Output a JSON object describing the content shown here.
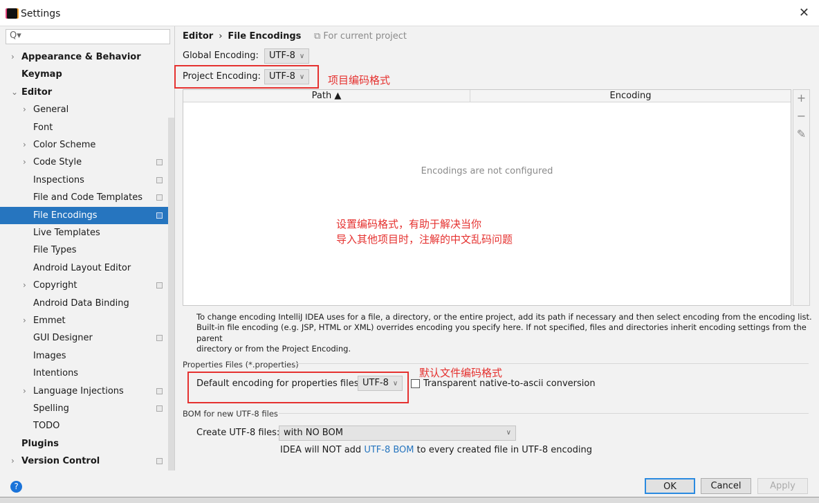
{
  "window": {
    "title": "Settings",
    "close_icon": "close-icon"
  },
  "sidebar": {
    "search_placeholder": "Q▾",
    "items": [
      {
        "label": "Appearance & Behavior",
        "level": 0,
        "bold": true,
        "arrow": "›",
        "project": false
      },
      {
        "label": "Keymap",
        "level": 0,
        "bold": true,
        "arrow": "",
        "project": false
      },
      {
        "label": "Editor",
        "level": 0,
        "bold": true,
        "arrow": "⌄",
        "project": false
      },
      {
        "label": "General",
        "level": 1,
        "arrow": "›",
        "project": false
      },
      {
        "label": "Font",
        "level": 1,
        "arrow": "",
        "project": false
      },
      {
        "label": "Color Scheme",
        "level": 1,
        "arrow": "›",
        "project": false
      },
      {
        "label": "Code Style",
        "level": 1,
        "arrow": "›",
        "project": true
      },
      {
        "label": "Inspections",
        "level": 1,
        "arrow": "",
        "project": true
      },
      {
        "label": "File and Code Templates",
        "level": 1,
        "arrow": "",
        "project": true
      },
      {
        "label": "File Encodings",
        "level": 1,
        "arrow": "",
        "project": true,
        "selected": true
      },
      {
        "label": "Live Templates",
        "level": 1,
        "arrow": "",
        "project": false
      },
      {
        "label": "File Types",
        "level": 1,
        "arrow": "",
        "project": false
      },
      {
        "label": "Android Layout Editor",
        "level": 1,
        "arrow": "",
        "project": false
      },
      {
        "label": "Copyright",
        "level": 1,
        "arrow": "›",
        "project": true
      },
      {
        "label": "Android Data Binding",
        "level": 1,
        "arrow": "",
        "project": false
      },
      {
        "label": "Emmet",
        "level": 1,
        "arrow": "›",
        "project": false
      },
      {
        "label": "GUI Designer",
        "level": 1,
        "arrow": "",
        "project": true
      },
      {
        "label": "Images",
        "level": 1,
        "arrow": "",
        "project": false
      },
      {
        "label": "Intentions",
        "level": 1,
        "arrow": "",
        "project": false
      },
      {
        "label": "Language Injections",
        "level": 1,
        "arrow": "›",
        "project": true
      },
      {
        "label": "Spelling",
        "level": 1,
        "arrow": "",
        "project": true
      },
      {
        "label": "TODO",
        "level": 1,
        "arrow": "",
        "project": false
      },
      {
        "label": "Plugins",
        "level": 0,
        "bold": true,
        "arrow": "",
        "project": false
      },
      {
        "label": "Version Control",
        "level": 0,
        "bold": true,
        "arrow": "›",
        "project": true
      }
    ]
  },
  "main": {
    "breadcrumb": {
      "parent": "Editor",
      "sep": "›",
      "current": "File Encodings"
    },
    "for_current_project": "For current project",
    "global_encoding": {
      "label": "Global Encoding:",
      "value": "UTF-8"
    },
    "project_encoding": {
      "label": "Project Encoding:",
      "value": "UTF-8"
    },
    "annotation_project": "项目编码格式",
    "table": {
      "columns": [
        "Path ▲",
        "Encoding"
      ],
      "empty_text": "Encodings are not configured"
    },
    "annotation_middle": [
      "设置编码格式，有助于解决当你",
      "导入其他项目时，注解的中文乱码问题"
    ],
    "help_text": [
      "To change encoding IntelliJ IDEA uses for a file, a directory, or the entire project, add its path if necessary and then select encoding from the encoding list.",
      "Built-in file encoding (e.g. JSP, HTML or XML) overrides encoding you specify here. If not specified, files and directories inherit encoding settings from the parent",
      "directory or from the Project Encoding."
    ],
    "properties": {
      "section": "Properties Files (*.properties)",
      "label": "Default encoding for properties files:",
      "value": "UTF-8",
      "transparent_label": "Transparent native-to-ascii conversion",
      "transparent_checked": false
    },
    "annotation_properties": "默认文件编码格式",
    "bom": {
      "section": "BOM for new UTF-8 files",
      "label": "Create UTF-8 files:",
      "value": "with NO BOM",
      "note_pre": "IDEA will NOT add ",
      "note_link": "UTF-8 BOM",
      "note_post": " to every created file in UTF-8 encoding"
    }
  },
  "footer": {
    "ok": "OK",
    "cancel": "Cancel",
    "apply": "Apply",
    "help_icon": "help-icon"
  },
  "colors": {
    "selection": "#2675bf",
    "annotation": "#e5312f",
    "link": "#2675bf"
  }
}
